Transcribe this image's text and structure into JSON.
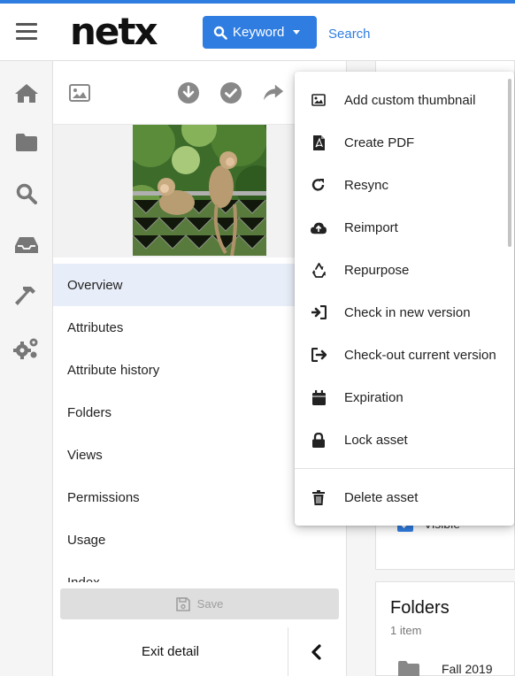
{
  "header": {
    "logo": "netx",
    "keyword_button": "Keyword",
    "search_link": "Search"
  },
  "rail": {
    "items": [
      "home-icon",
      "folder-icon",
      "search-icon",
      "inbox-icon",
      "hammer-icon",
      "cogs-icon"
    ]
  },
  "toolbar": {
    "icons": [
      "image-icon",
      "download-icon",
      "check-circle-icon",
      "share-icon"
    ]
  },
  "nav": {
    "items": [
      "Overview",
      "Attributes",
      "Attribute history",
      "Folders",
      "Views",
      "Permissions",
      "Usage",
      "Index"
    ],
    "active": "Overview"
  },
  "footer": {
    "save_label": "Save",
    "exit_label": "Exit detail"
  },
  "right_panel": {
    "visible_label": "Visible",
    "folders_title": "Folders",
    "folders_count": "1 item",
    "folder_name": "Fall 2019"
  },
  "menu": {
    "items": [
      {
        "label": "Add custom thumbnail",
        "icon": "image-icon"
      },
      {
        "label": "Create PDF",
        "icon": "pdf-icon"
      },
      {
        "label": "Resync",
        "icon": "redo-icon"
      },
      {
        "label": "Reimport",
        "icon": "cloud-upload-icon"
      },
      {
        "label": "Repurpose",
        "icon": "recycle-icon"
      },
      {
        "label": "Check in new version",
        "icon": "sign-in-icon"
      },
      {
        "label": "Check-out current version",
        "icon": "sign-out-icon"
      },
      {
        "label": "Expiration",
        "icon": "calendar-icon"
      },
      {
        "label": "Lock asset",
        "icon": "lock-icon"
      },
      {
        "label": "Delete asset",
        "icon": "trash-icon"
      }
    ]
  },
  "colors": {
    "accent": "#2f7de1",
    "active_nav": "#e8eef9",
    "icon_gray": "#777777"
  }
}
